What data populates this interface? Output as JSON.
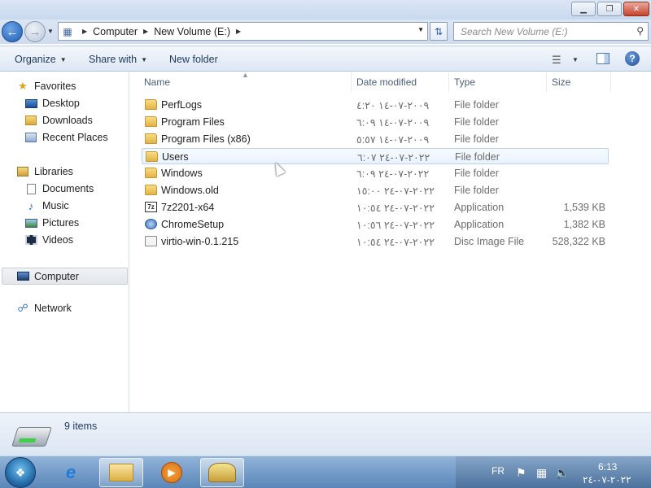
{
  "window": {
    "minimize": "▁",
    "maximize": "❐",
    "close": "✕"
  },
  "address": {
    "crumbs": [
      "Computer",
      "New Volume (E:)"
    ],
    "search_placeholder": "Search New Volume (E:)"
  },
  "toolbar": {
    "organize": "Organize",
    "share_with": "Share with",
    "new_folder": "New folder"
  },
  "nav": {
    "favorites": "Favorites",
    "desktop": "Desktop",
    "downloads": "Downloads",
    "recent_places": "Recent Places",
    "libraries": "Libraries",
    "documents": "Documents",
    "music": "Music",
    "pictures": "Pictures",
    "videos": "Videos",
    "computer": "Computer",
    "network": "Network"
  },
  "columns": {
    "name": "Name",
    "date": "Date modified",
    "type": "Type",
    "size": "Size"
  },
  "files": [
    {
      "name": "PerfLogs",
      "date": "٢٠٠٩-٠٧-١٤ ٤:٢٠",
      "type": "File folder",
      "size": ""
    },
    {
      "name": "Program Files",
      "date": "٢٠٠٩-٠٧-١٤ ٦:٠٩",
      "type": "File folder",
      "size": ""
    },
    {
      "name": "Program Files (x86)",
      "date": "٢٠٠٩-٠٧-١٤ ٥:٥٧",
      "type": "File folder",
      "size": ""
    },
    {
      "name": "Users",
      "date": "٢٠٢٢-٠٧-٢٤ ٦:٠٧",
      "type": "File folder",
      "size": ""
    },
    {
      "name": "Windows",
      "date": "٢٠٢٢-٠٧-٢٤ ٦:٠٩",
      "type": "File folder",
      "size": ""
    },
    {
      "name": "Windows.old",
      "date": "٢٠٢٢-٠٧-٢٤ ١٥:٠٠",
      "type": "File folder",
      "size": ""
    },
    {
      "name": "7z2201-x64",
      "date": "٢٠٢٢-٠٧-٢٤ ١٠:٥٤",
      "type": "Application",
      "size": "1,539 KB"
    },
    {
      "name": "ChromeSetup",
      "date": "٢٠٢٢-٠٧-٢٤ ١٠:٥٦",
      "type": "Application",
      "size": "1,382 KB"
    },
    {
      "name": "virtio-win-0.1.215",
      "date": "٢٠٢٢-٠٧-٢٤ ١٠:٥٤",
      "type": "Disc Image File",
      "size": "528,322 KB"
    }
  ],
  "details": {
    "item_count": "9 items"
  },
  "taskbar": {
    "language": "FR",
    "time": "6:13",
    "date": "٢٠٢٢-٠٧-٢٤"
  }
}
